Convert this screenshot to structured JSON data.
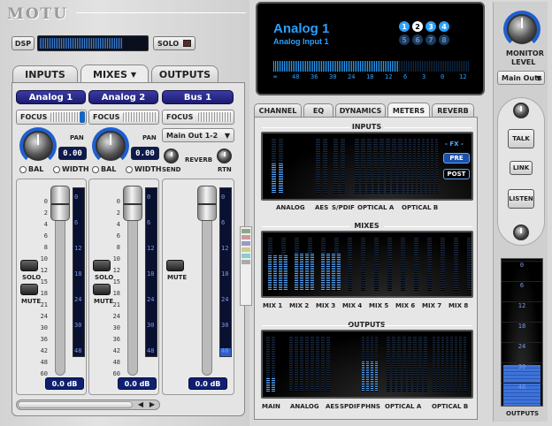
{
  "app": {
    "logo": "MOTU"
  },
  "top": {
    "dsp_label": "DSP",
    "dsp_meter_fraction": 0.78,
    "solo_label": "SOLO"
  },
  "tabs": [
    "INPUTS",
    "MIXES",
    "OUTPUTS"
  ],
  "tab_arrow": "▼",
  "strips": [
    {
      "name": "Analog 1",
      "focus": "FOCUS",
      "pan_label": "PAN",
      "pan_value": "0.00",
      "bal": "BAL",
      "width": "WIDTH",
      "solo": "SOLO",
      "mute": "MUTE",
      "db": "0.0 dB",
      "meter_fraction": 0.0
    },
    {
      "name": "Analog 2",
      "focus": "FOCUS",
      "pan_label": "PAN",
      "pan_value": "0.00",
      "bal": "BAL",
      "width": "WIDTH",
      "solo": "SOLO",
      "mute": "MUTE",
      "db": "0.0 dB",
      "meter_fraction": 0.0
    },
    {
      "name": "Bus 1",
      "focus": "FOCUS",
      "routing": "Main Out 1-2",
      "send": "SEND",
      "reverb": "REVERB",
      "rtn": "RTN",
      "mute": "MUTE",
      "db": "0.0 dB",
      "meter_fraction": 0.05
    }
  ],
  "fader_scale_a": [
    "0",
    "2",
    "4",
    "6",
    "8",
    "10",
    "12",
    "15",
    "18",
    "21",
    "24",
    "30",
    "36",
    "42",
    "48",
    "60"
  ],
  "fader_scale_b": [
    "0",
    "2",
    "4",
    "6",
    "8",
    "10",
    "12",
    "15",
    "18",
    "21",
    "24",
    "30",
    "36",
    "42",
    "48",
    "60"
  ],
  "meter_scale": [
    "0",
    "6",
    "12",
    "18",
    "24",
    "30",
    "48"
  ],
  "display": {
    "title": "Analog 1",
    "subtitle": "Analog Input 1",
    "pages_top": [
      "1",
      "2",
      "3",
      "4"
    ],
    "pages_bottom": [
      "5",
      "6",
      "7",
      "8"
    ],
    "active_page": "2",
    "scale": [
      "∞",
      "48",
      "36",
      "30",
      "24",
      "18",
      "12",
      "6",
      "3",
      "0",
      "12"
    ]
  },
  "view_tabs": [
    "CHANNEL",
    "EQ",
    "DYNAMICS",
    "METERS",
    "REVERB"
  ],
  "active_view_tab": "METERS",
  "meters": {
    "inputs": {
      "title": "INPUTS",
      "fx_label": "- FX -",
      "pre": "PRE",
      "post": "POST",
      "labels": [
        "ANALOG",
        "AES",
        "S/PDIF",
        "OPTICAL A",
        "OPTICAL B"
      ]
    },
    "mixes": {
      "title": "MIXES",
      "labels": [
        "MIX 1",
        "MIX 2",
        "MIX 3",
        "MIX 4",
        "MIX 5",
        "MIX 6",
        "MIX 7",
        "MIX 8"
      ]
    },
    "outputs": {
      "title": "OUTPUTS",
      "labels": [
        "MAIN",
        "ANALOG",
        "AES",
        "SPDIF",
        "PHNS",
        "OPTICAL A",
        "OPTICAL B"
      ]
    }
  },
  "monitor": {
    "label_1": "MONITOR",
    "label_2": "LEVEL",
    "output": "Main Outs",
    "talk": "TALK",
    "link": "LINK",
    "listen": "LISTEN",
    "scale": [
      "0",
      "6",
      "12",
      "18",
      "24",
      "30",
      "48"
    ],
    "footer": "OUTPUTS"
  },
  "colors": {
    "accent": "#1e5fd0",
    "lcd": "#0d1a4a",
    "strip_name": "#24248a",
    "meter": "#5aa8ff"
  }
}
